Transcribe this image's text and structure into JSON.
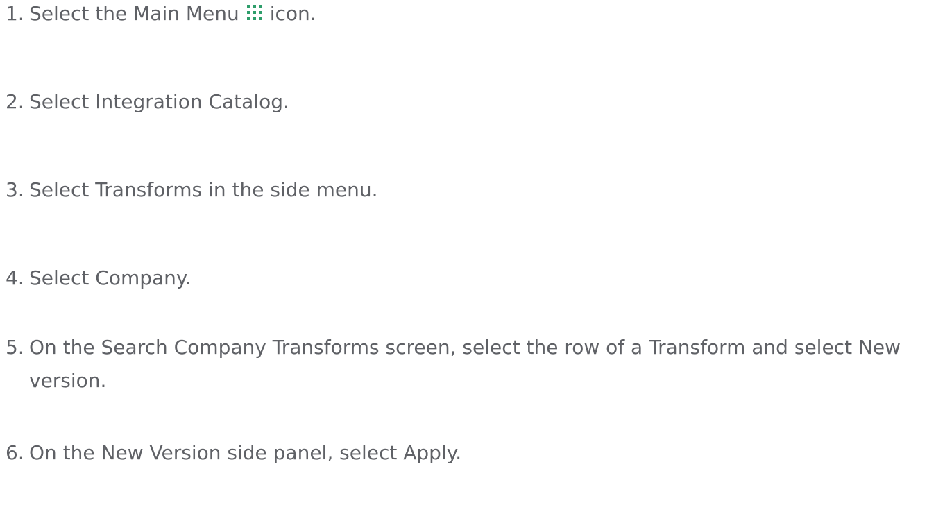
{
  "steps": [
    {
      "number": "1.",
      "text_before_icon": "Select the Main Menu",
      "icon": "main-menu-grid-icon",
      "text_after_icon": "icon."
    },
    {
      "number": "2.",
      "text": "Select Integration Catalog."
    },
    {
      "number": "3.",
      "text": "Select Transforms in the side menu."
    },
    {
      "number": "4.",
      "text": "Select Company."
    },
    {
      "number": "5.",
      "text": "On the Search Company Transforms screen, select the row of a Transform and select New version."
    },
    {
      "number": "6.",
      "text": "On the New Version side panel, select Apply."
    }
  ],
  "colors": {
    "text": "#5f6166",
    "icon": "#2e9e6b"
  }
}
